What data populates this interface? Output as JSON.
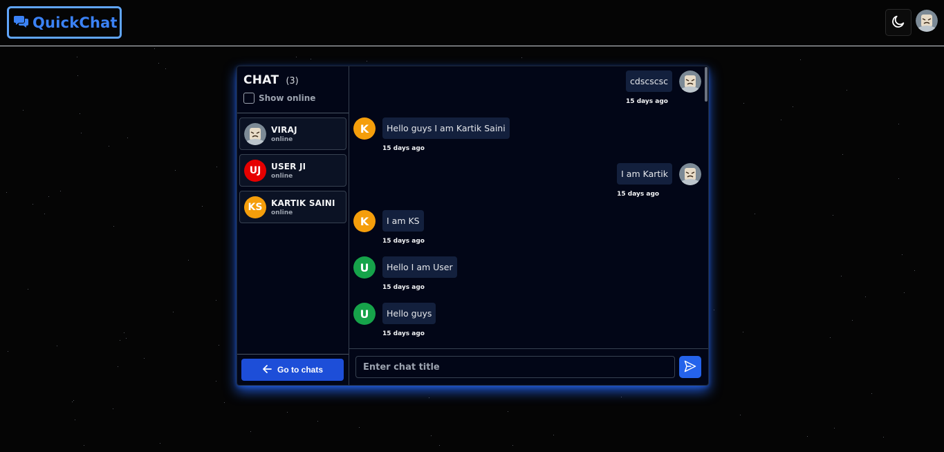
{
  "header": {
    "logo_text": "QuickChat",
    "theme_toggle_icon": "moon-icon"
  },
  "sidebar": {
    "title": "CHAT",
    "count": "(3)",
    "show_online_label": "Show online",
    "users": [
      {
        "name": "VIRAJ",
        "status": "online",
        "avatar_initials": "",
        "avatar_type": "image"
      },
      {
        "name": "USER JI",
        "status": "online",
        "avatar_initials": "UJ",
        "avatar_color": "#e60000"
      },
      {
        "name": "KARTIK SAINI",
        "status": "online",
        "avatar_initials": "KS",
        "avatar_color": "#f59e0b"
      }
    ],
    "goto_button_label": "Go to chats"
  },
  "messages": [
    {
      "side": "right",
      "text": "cdscscsc",
      "time": "15 days ago",
      "avatar_type": "image"
    },
    {
      "side": "left",
      "text": "Hello guys I am Kartik Saini",
      "time": "15 days ago",
      "avatar_initials": "K",
      "avatar_color": "#f59e0b"
    },
    {
      "side": "right",
      "text": "I am Kartik",
      "time": "15 days ago",
      "avatar_type": "image"
    },
    {
      "side": "left",
      "text": "I am KS",
      "time": "15 days ago",
      "avatar_initials": "K",
      "avatar_color": "#f59e0b"
    },
    {
      "side": "left",
      "text": "Hello I am User",
      "time": "15 days ago",
      "avatar_initials": "U",
      "avatar_color": "#16a34a"
    },
    {
      "side": "left",
      "text": "Hello guys",
      "time": "15 days ago",
      "avatar_initials": "U",
      "avatar_color": "#16a34a"
    }
  ],
  "composer": {
    "placeholder": "Enter chat title",
    "value": ""
  },
  "colors": {
    "accent": "#2563eb",
    "bubble": "#13203d",
    "panel": "#020617"
  }
}
